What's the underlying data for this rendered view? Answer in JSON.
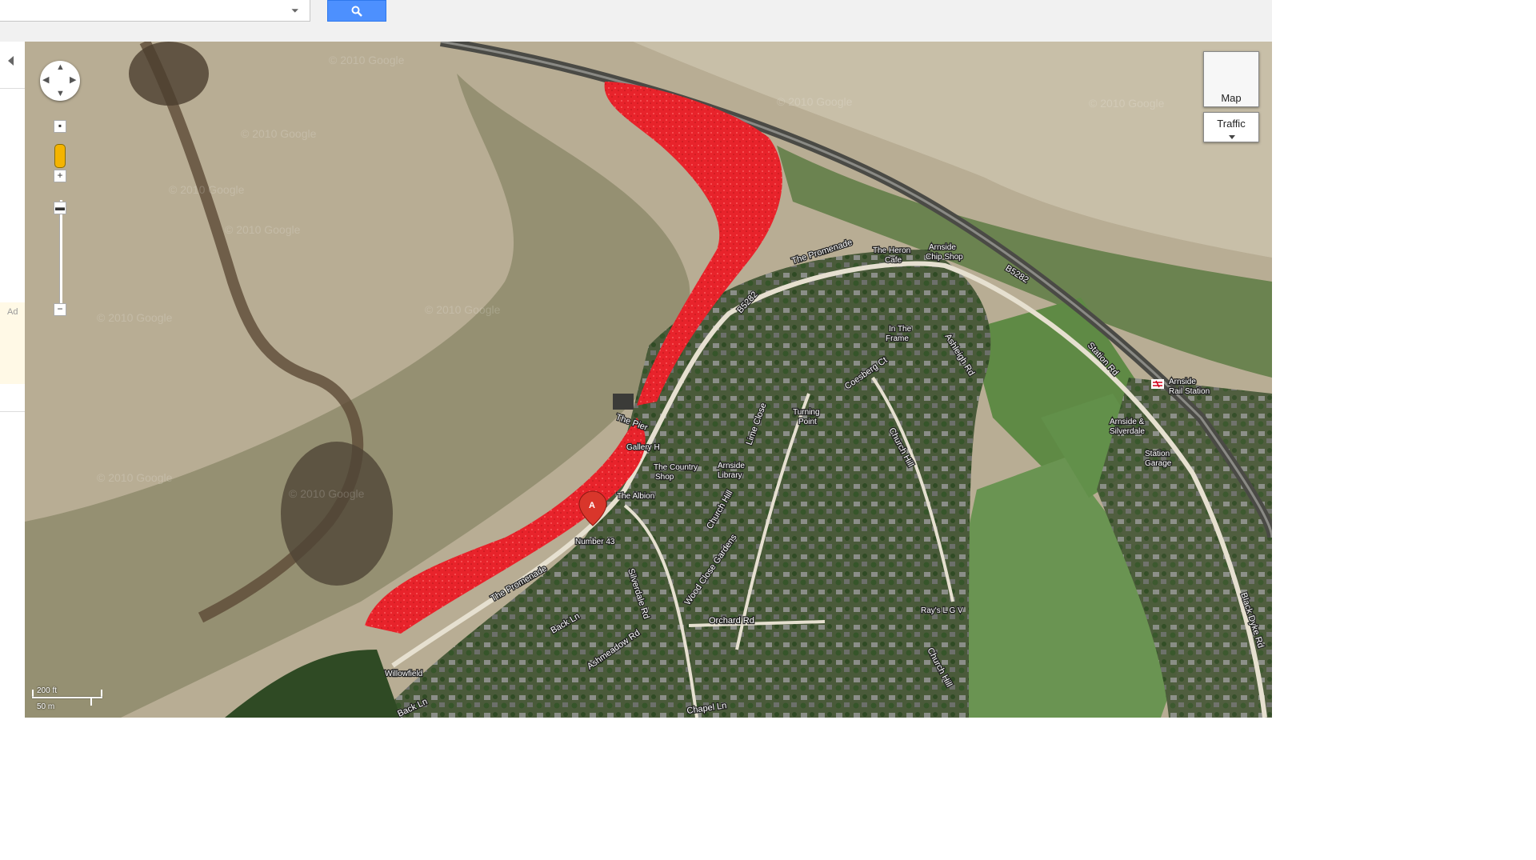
{
  "search": {
    "query": "",
    "dropdown_glyph": "⏷",
    "button_icon": "search-icon"
  },
  "sidebar": {
    "ad_label": "Ad",
    "collapse_icon": "chevron-left-icon"
  },
  "map": {
    "view": "satellite",
    "highlight_color": "#e8232b",
    "marker": {
      "letter": "A",
      "color": "#d9362b"
    },
    "watermark": "© 2010 Google",
    "controls": {
      "map_type_label": "Map",
      "traffic_label": "Traffic",
      "zoom_in": "+",
      "zoom_out": "−"
    },
    "scale": {
      "feet": "200 ft",
      "meters": "50 m"
    },
    "road_labels": {
      "promenade_north": "The Promenade",
      "promenade_south": "The Promenade",
      "b5282_a": "B5282",
      "b5282_b": "B5282",
      "station_rd": "Station Rd",
      "the_pier": "The Pier",
      "silverdale_rd": "Silverdale Rd",
      "wood_close_gardens": "Wood Close Gardens",
      "church_hill_a": "Church Hill",
      "church_hill_b": "Church Hill",
      "church_hill_c": "Church Hill",
      "orchard_rd": "Orchard Rd",
      "chapel_ln": "Chapel Ln",
      "back_ln_a": "Back Ln",
      "back_ln_b": "Back Ln",
      "ashmeadow_rd": "Ashmeadow Rd",
      "ashleigh_rd": "Ashleigh Rd",
      "coesberg_ct": "Coesberg Ct",
      "black_dyke_rd": "Black Dyke Rd",
      "lime_close": "Lime Close"
    },
    "poi_labels": {
      "heron_cafe_1": "The Heron",
      "heron_cafe_2": "Cafe",
      "chip_shop_1": "Arnside",
      "chip_shop_2": "Chip Shop",
      "in_the_frame_1": "In The",
      "in_the_frame_2": "Frame",
      "rail_station_1": "Arnside",
      "rail_station_2": "Rail Station",
      "arnside_silverdale_1": "Arnside &",
      "arnside_silverdale_2": "Silverdale",
      "station_garage_1": "Station",
      "station_garage_2": "Garage",
      "turning_point_1": "Turning",
      "turning_point_2": "Point",
      "gallery": "Gallery H",
      "country_shop_1": "The Country",
      "country_shop_2": "Shop",
      "library_1": "Arnside",
      "library_2": "Library",
      "albion": "The Albion",
      "number43": "Number 43",
      "rays": "Ray's L G V",
      "willowfield": "Willowfield"
    }
  }
}
